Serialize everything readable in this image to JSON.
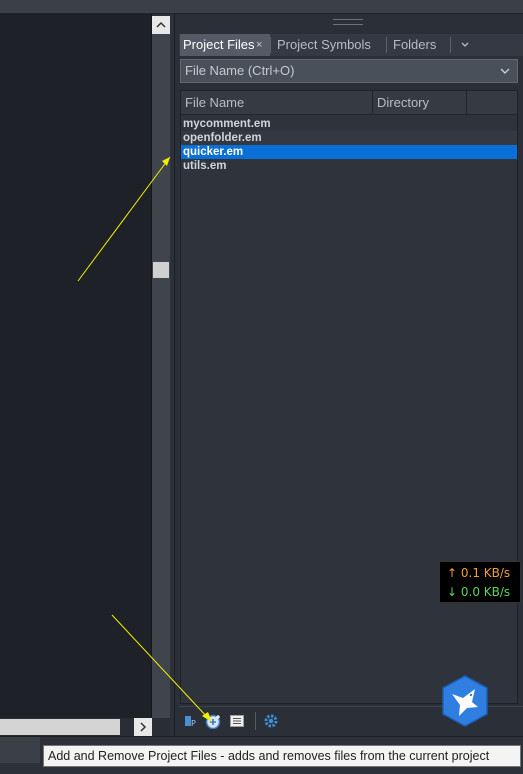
{
  "panel": {
    "tabs": [
      {
        "label": "Project Files",
        "active": true
      },
      {
        "label": "Project Symbols",
        "active": false
      },
      {
        "label": "Folders",
        "active": false
      }
    ],
    "tab_close_glyph": "×",
    "search": {
      "placeholder": "File Name (Ctrl+O)"
    },
    "columns": [
      "File Name",
      "Directory"
    ],
    "files": [
      {
        "name": "mycomment.em",
        "selected": false
      },
      {
        "name": "openfolder.em",
        "selected": false
      },
      {
        "name": "quicker.em",
        "selected": true
      },
      {
        "name": "utils.em",
        "selected": false
      }
    ],
    "toolbar_icons": [
      "project-files-icon",
      "add-remove-files-icon",
      "file-list-icon",
      "settings-gear-icon"
    ]
  },
  "tooltip": "Add and Remove Project Files - adds and removes files from the current project",
  "network": {
    "upload": "↑ 0.1 KB/s",
    "download": "↓ 0.0 KB/s"
  },
  "colors": {
    "selection": "#0a6fd6",
    "upload": "#f0a030",
    "download": "#5bd65b",
    "annotation": "#f2f200"
  }
}
